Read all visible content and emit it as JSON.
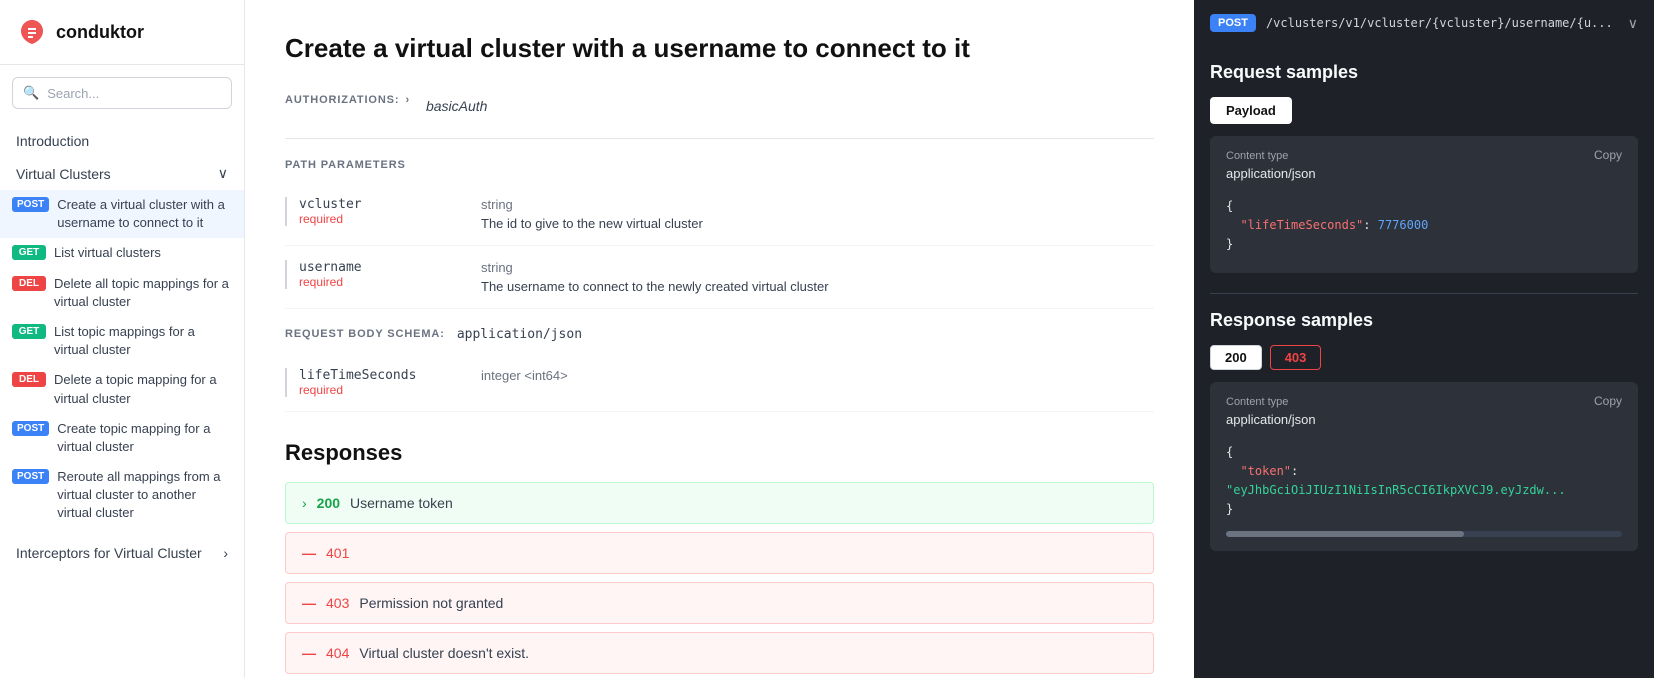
{
  "sidebar": {
    "logo_text": "conduktor",
    "search_placeholder": "Search...",
    "nav_items": [
      {
        "id": "introduction",
        "label": "Introduction",
        "type": "link"
      },
      {
        "id": "virtual-clusters",
        "label": "Virtual Clusters",
        "type": "section",
        "expanded": true
      },
      {
        "id": "create-virtual-cluster",
        "label": "Create a virtual cluster with a username to connect to it",
        "method": "POST",
        "badge_class": "badge-post",
        "active": true
      },
      {
        "id": "list-virtual-clusters",
        "label": "List virtual clusters",
        "method": "GET",
        "badge_class": "badge-get"
      },
      {
        "id": "delete-all-topic-mappings",
        "label": "Delete all topic mappings for a virtual cluster",
        "method": "DEL",
        "badge_class": "badge-del"
      },
      {
        "id": "list-topic-mappings",
        "label": "List topic mappings for a virtual cluster",
        "method": "GET",
        "badge_class": "badge-get"
      },
      {
        "id": "delete-topic-mapping",
        "label": "Delete a topic mapping for a virtual cluster",
        "method": "DEL",
        "badge_class": "badge-del"
      },
      {
        "id": "create-topic-mapping",
        "label": "Create topic mapping for a virtual cluster",
        "method": "POST",
        "badge_class": "badge-post"
      },
      {
        "id": "reroute-mappings",
        "label": "Reroute all mappings from a virtual cluster to another virtual cluster",
        "method": "POST",
        "badge_class": "badge-post"
      },
      {
        "id": "interceptors-section",
        "label": "Interceptors for Virtual Cluster",
        "type": "section-link"
      }
    ]
  },
  "main": {
    "title": "Create a virtual cluster with a username to connect to it",
    "authorizations_label": "AUTHORIZATIONS:",
    "auth_value": "basicAuth",
    "path_params_label": "PATH PARAMETERS",
    "params": [
      {
        "name": "vcluster",
        "required": "required",
        "type": "string",
        "description": "The id to give to the new virtual cluster"
      },
      {
        "name": "username",
        "required": "required",
        "type": "string",
        "description": "The username to connect to the newly created virtual cluster"
      }
    ],
    "request_body_schema_label": "REQUEST BODY SCHEMA:",
    "request_body_schema_value": "application/json",
    "body_params": [
      {
        "name": "lifeTimeSeconds",
        "required": "required",
        "type": "integer <int64>",
        "description": ""
      }
    ],
    "responses_title": "Responses",
    "responses": [
      {
        "code": "200",
        "label": "Username token",
        "style": "green",
        "expanded": true
      },
      {
        "code": "401",
        "label": "",
        "style": "red"
      },
      {
        "code": "403",
        "label": "Permission not granted",
        "style": "red"
      },
      {
        "code": "404",
        "label": "Virtual cluster doesn't exist.",
        "style": "red"
      }
    ]
  },
  "right_panel": {
    "method": "POST",
    "endpoint": "/vclusters/v1/vcluster/{vcluster}/username/{u...",
    "request_samples_title": "Request samples",
    "payload_tab": "Payload",
    "content_type_label": "Content type",
    "content_type_value": "application/json",
    "copy_label": "Copy",
    "code_sample": {
      "lifetime_key": "\"lifeTimeSeconds\"",
      "lifetime_value": "7776000"
    },
    "response_samples_title": "Response samples",
    "response_tabs": [
      {
        "code": "200",
        "class": "resp-tab-200"
      },
      {
        "code": "403",
        "class": "resp-tab-403"
      }
    ],
    "response_content_type_label": "Content type",
    "response_content_type_value": "application/json",
    "response_copy_label": "Copy",
    "response_code": {
      "token_key": "\"token\"",
      "token_value": "\"eyJhbGciOiJIUzI1NiIsInR5cCI6IkpXVCJ9.eyJzdw..."
    }
  }
}
